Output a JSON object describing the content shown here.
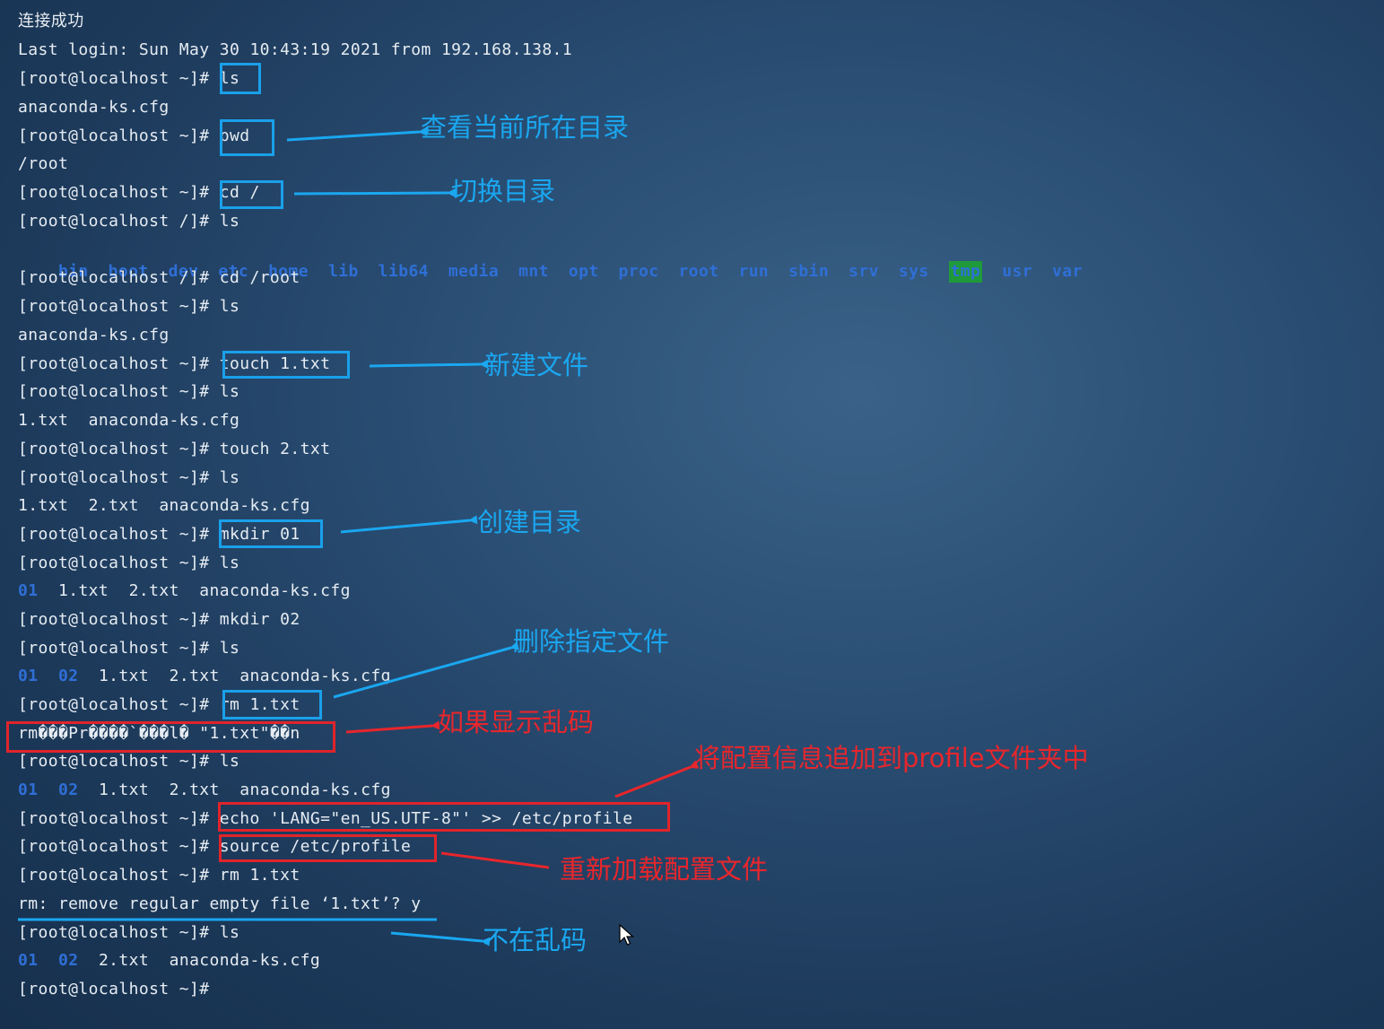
{
  "terminal": {
    "lines": [
      "连接成功",
      "Last login: Sun May 30 10:43:19 2021 from 192.168.138.1",
      "[root@localhost ~]# ls",
      "anaconda-ks.cfg",
      "[root@localhost ~]# pwd",
      "/root",
      "[root@localhost ~]# cd /",
      "[root@localhost /]# ls",
      "",
      "[root@localhost /]# cd /root",
      "[root@localhost ~]# ls",
      "anaconda-ks.cfg",
      "[root@localhost ~]# touch 1.txt",
      "[root@localhost ~]# ls",
      "1.txt  anaconda-ks.cfg",
      "[root@localhost ~]# touch 2.txt",
      "[root@localhost ~]# ls",
      "1.txt  2.txt  anaconda-ks.cfg",
      "[root@localhost ~]# mkdir 01",
      "[root@localhost ~]# ls",
      "",
      "[root@localhost ~]# mkdir 02",
      "[root@localhost ~]# ls",
      "",
      "[root@localhost ~]# rm 1.txt",
      "rm���Pr����`���l� \"1.txt\"��n",
      "[root@localhost ~]# ls",
      "",
      "[root@localhost ~]# echo 'LANG=\"en_US.UTF-8\"' >> /etc/profile",
      "[root@localhost ~]# source /etc/profile",
      "[root@localhost ~]# rm 1.txt",
      "rm: remove regular empty file ‘1.txt’? y",
      "[root@localhost ~]# ls",
      "",
      "[root@localhost ~]#"
    ],
    "root_dirs": [
      "bin",
      "boot",
      "dev",
      "etc",
      "home",
      "lib",
      "lib64",
      "media",
      "mnt",
      "opt",
      "proc",
      "root",
      "run",
      "sbin",
      "srv",
      "sys",
      "tmp",
      "usr",
      "var"
    ],
    "ls_after_mkdir01": {
      "dirs": [
        "01"
      ],
      "files": "1.txt  2.txt  anaconda-ks.cfg"
    },
    "ls_after_mkdir02": {
      "dirs": [
        "01",
        "02"
      ],
      "files": "1.txt  2.txt  anaconda-ks.cfg"
    },
    "ls_after_garbled": {
      "dirs": [
        "01",
        "02"
      ],
      "files": "1.txt  2.txt  anaconda-ks.cfg"
    },
    "ls_final": {
      "dirs": [
        "01",
        "02"
      ],
      "files": "2.txt  anaconda-ks.cfg"
    }
  },
  "annotations": {
    "pwd": "查看当前所在目录",
    "cd": "切换目录",
    "touch": "新建文件",
    "mkdir": "创建目录",
    "rm": "删除指定文件",
    "garbled": "如果显示乱码",
    "echo": "将配置信息追加到profile文件夹中",
    "source": "重新加载配置文件",
    "fixed": "不在乱码"
  },
  "colors": {
    "annotation_blue": "#1aa7f0",
    "annotation_red": "#e8262c",
    "dir_blue": "#2f6fd6",
    "tmp_highlight": "#1f9a3a"
  }
}
